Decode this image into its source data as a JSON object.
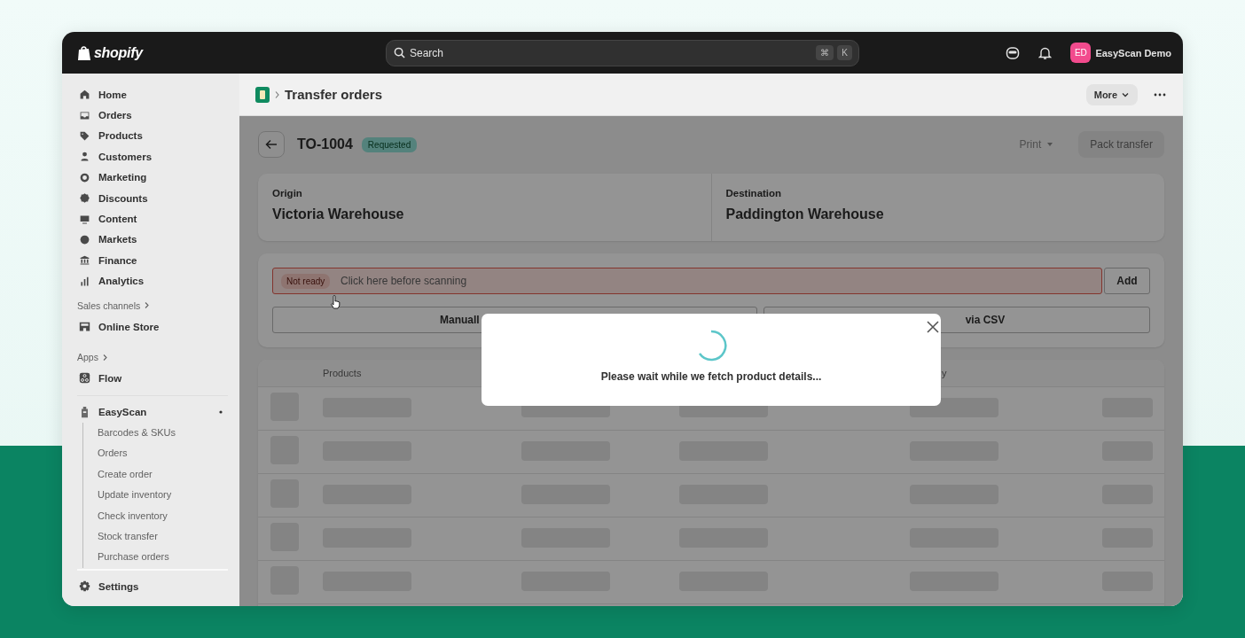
{
  "topbar": {
    "logo": "shopify",
    "search": {
      "placeholder": "Search"
    },
    "shortcut": [
      "⌘",
      "K"
    ],
    "user": {
      "initials": "ED",
      "name": "EasyScan Demo"
    }
  },
  "sidebar": {
    "nav": [
      {
        "label": "Home"
      },
      {
        "label": "Orders"
      },
      {
        "label": "Products"
      },
      {
        "label": "Customers"
      },
      {
        "label": "Marketing"
      },
      {
        "label": "Discounts"
      },
      {
        "label": "Content"
      },
      {
        "label": "Markets"
      },
      {
        "label": "Finance"
      },
      {
        "label": "Analytics"
      }
    ],
    "sales_channels": {
      "title": "Sales channels",
      "items": [
        {
          "label": "Online Store"
        }
      ]
    },
    "apps": {
      "title": "Apps",
      "items": [
        {
          "label": "Flow"
        }
      ]
    },
    "app": {
      "label": "EasyScan",
      "children": [
        {
          "label": "Barcodes & SKUs"
        },
        {
          "label": "Orders"
        },
        {
          "label": "Create order"
        },
        {
          "label": "Update inventory"
        },
        {
          "label": "Check inventory"
        },
        {
          "label": "Stock transfer"
        },
        {
          "label": "Purchase orders"
        }
      ]
    },
    "settings": {
      "label": "Settings"
    }
  },
  "page_header": {
    "title": "Transfer orders",
    "more": "More"
  },
  "order": {
    "id": "TO-1004",
    "status": "Requested",
    "actions": [
      "Print",
      "Pack transfer"
    ],
    "origin": {
      "label": "Origin",
      "value": "Victoria Warehouse"
    },
    "destination": {
      "label": "Destination",
      "value": "Paddington Warehouse"
    }
  },
  "scan": {
    "status": "Not ready",
    "ready": false,
    "placeholder": "Click here before scanning",
    "add": "Add",
    "buttons": [
      "Manuall",
      "via CSV"
    ]
  },
  "table": {
    "columns": [
      "Products",
      "y"
    ],
    "rows": [
      {
        "kind": "skeleton"
      },
      {
        "kind": "skeleton"
      },
      {
        "kind": "skeleton"
      },
      {
        "kind": "skeleton"
      },
      {
        "kind": "skeleton"
      }
    ]
  },
  "modal": {
    "message": "Please wait while we fetch product details...",
    "loading": true
  }
}
